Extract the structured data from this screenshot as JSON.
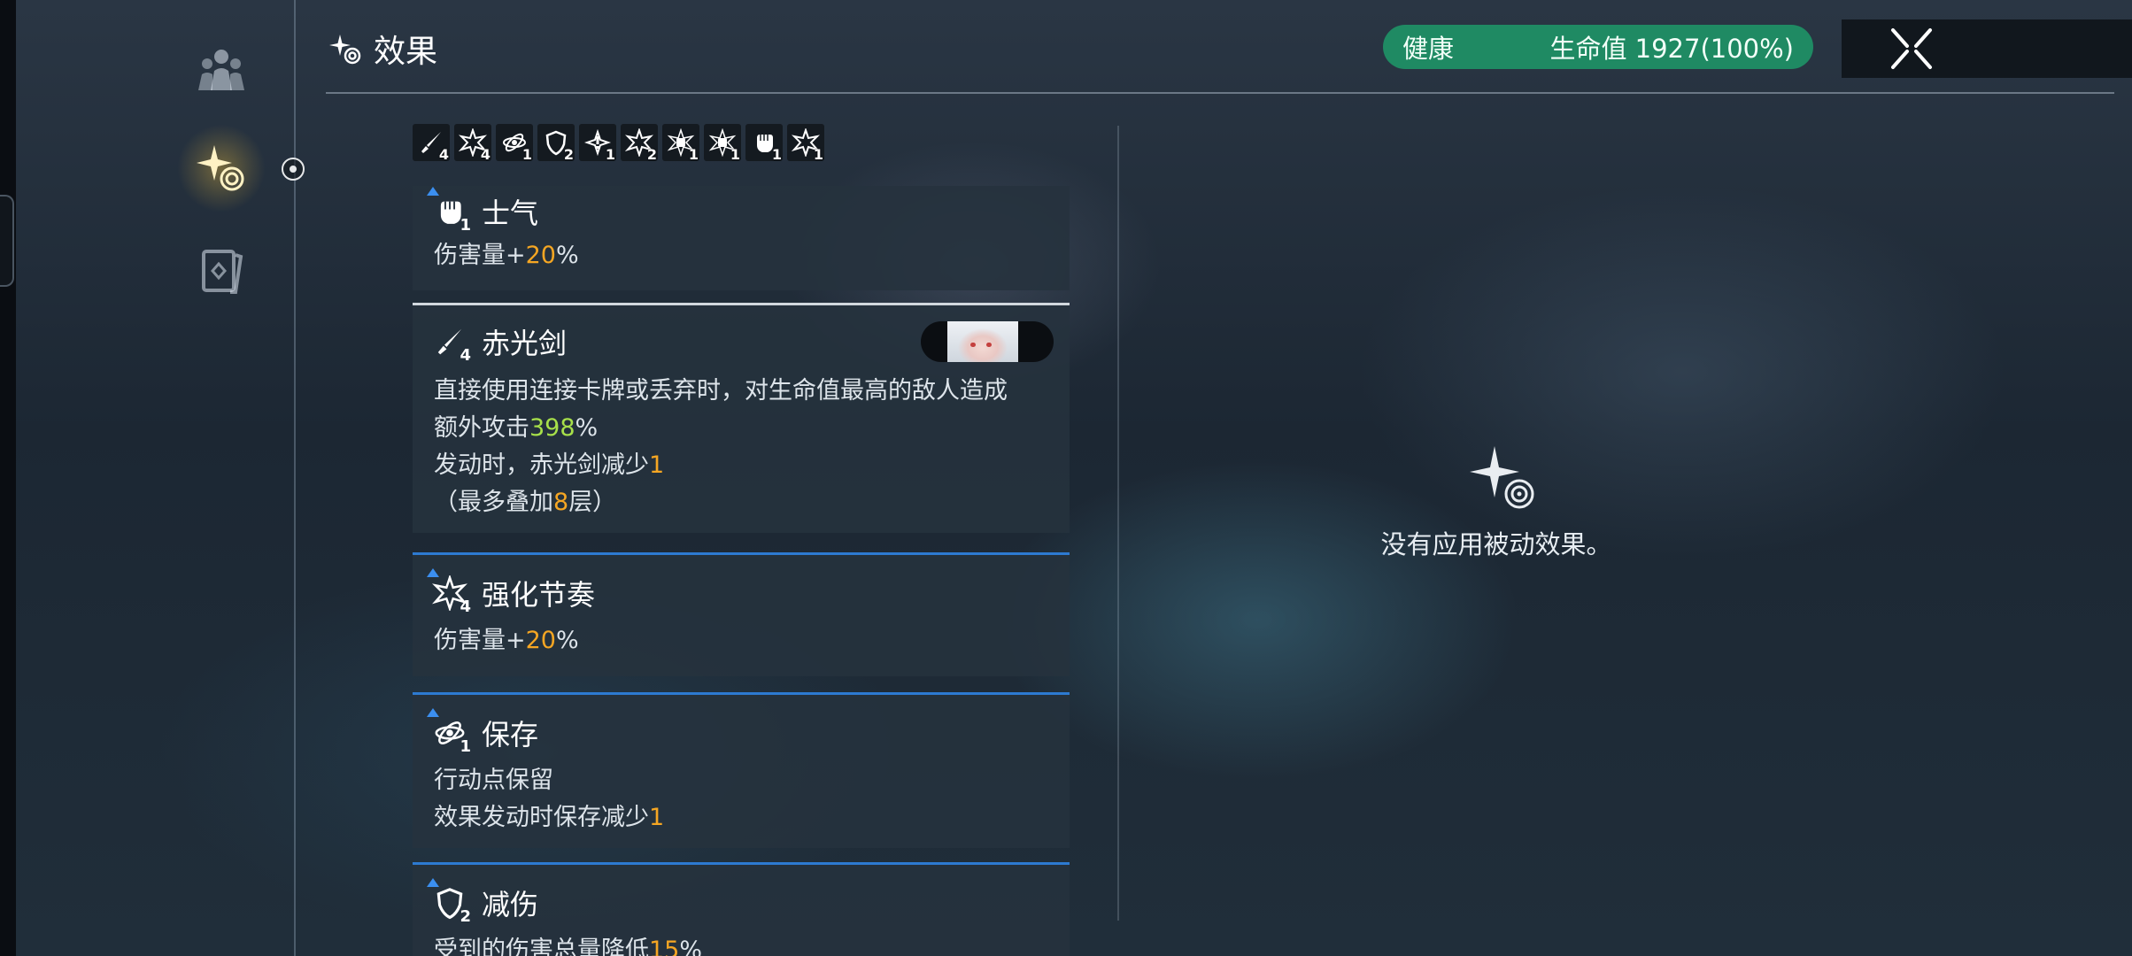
{
  "header": {
    "title": "效果",
    "status_label": "健康",
    "hp_text": "生命值 1927(100%)"
  },
  "sidebar": {
    "items": [
      {
        "icon": "party-icon",
        "active": false
      },
      {
        "icon": "effects-sparkle-icon",
        "active": true
      },
      {
        "icon": "cards-icon",
        "active": false
      }
    ]
  },
  "effect_bar": [
    {
      "icon": "sword-icon",
      "count": "4"
    },
    {
      "icon": "burst-icon",
      "count": "4"
    },
    {
      "icon": "atom-icon",
      "count": "1"
    },
    {
      "icon": "shield-icon",
      "count": "2"
    },
    {
      "icon": "warning-burst-icon",
      "count": "1"
    },
    {
      "icon": "burst-icon",
      "count": "2"
    },
    {
      "icon": "burst-fist-icon",
      "count": "1"
    },
    {
      "icon": "burst-fist-icon",
      "count": "1"
    },
    {
      "icon": "fist-icon",
      "count": "1"
    },
    {
      "icon": "burst-icon",
      "count": "1"
    }
  ],
  "effects": [
    {
      "name": "士气",
      "icon": "fist-icon",
      "count": "1",
      "lines": [
        [
          "伤害量+",
          "20",
          "%"
        ]
      ]
    },
    {
      "name": "赤光剑",
      "icon": "sword-icon",
      "count": "4",
      "line1": "直接使用连接卡牌或丢弃时，对生命值最高的敌人造成",
      "line2_pre": "额外攻击",
      "line2_val": "398",
      "line2_post": "%",
      "line3_pre": "发动时，赤光剑减少",
      "line3_val": "1",
      "line4_pre": "（最多叠加",
      "line4_val": "8",
      "line4_post": "层）"
    },
    {
      "name": "强化节奏",
      "icon": "burst-icon",
      "count": "4",
      "lines": [
        [
          "伤害量+",
          "20",
          "%"
        ]
      ]
    },
    {
      "name": "保存",
      "icon": "atom-icon",
      "count": "1",
      "line1": "行动点保留",
      "line2_pre": "效果发动时保存减少",
      "line2_val": "1"
    },
    {
      "name": "减伤",
      "icon": "shield-icon",
      "count": "2",
      "line1_pre": "受到的伤害总量降低",
      "line1_val": "15",
      "line1_post": "%"
    }
  ],
  "passive": {
    "empty_text": "没有应用被动效果。"
  },
  "colors": {
    "health_green": "#1f8a63",
    "accent_blue": "#2d7ad1",
    "value_orange": "#f5a623",
    "value_green": "#a7e04a"
  }
}
